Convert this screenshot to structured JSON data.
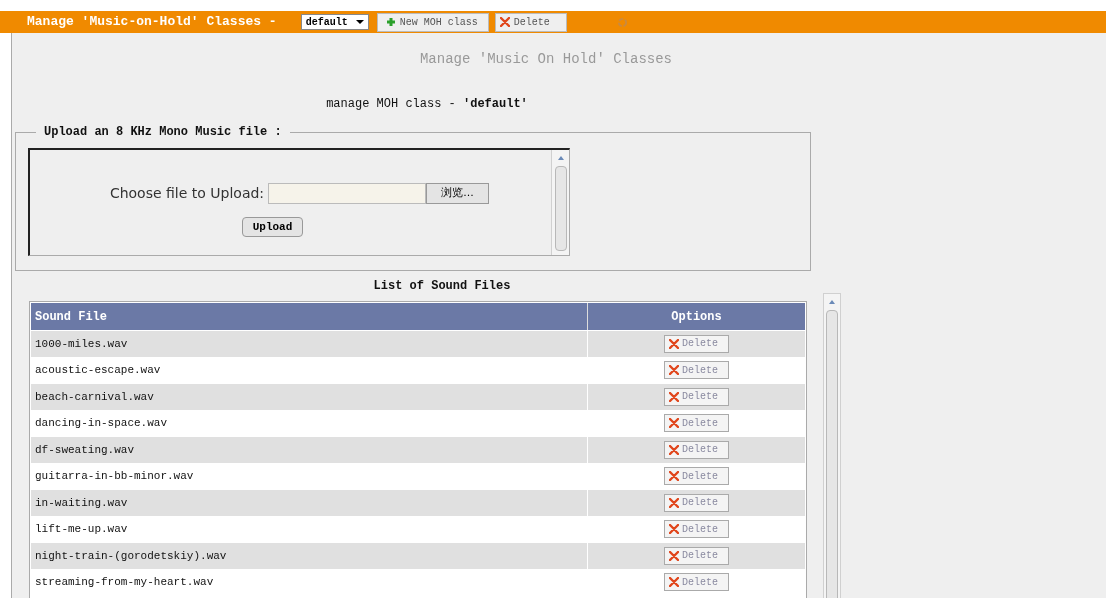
{
  "toolbar": {
    "title": "Manage 'Music-on-Hold' Classes -",
    "class_select": "default",
    "new_button": "New MOH class",
    "delete_button": "Delete"
  },
  "heading": "Manage 'Music On Hold' Classes",
  "subheading": "manage MOH class - **'default'**",
  "upload": {
    "legend": "Upload an 8 KHz Mono Music file :",
    "label": "Choose file to Upload:",
    "browse": "浏览...",
    "submit": "Upload"
  },
  "list_title": "List of Sound Files",
  "table": {
    "columns": [
      "Sound File",
      "Options"
    ],
    "rows": [
      {
        "file": "1000-miles.wav",
        "action": "Delete"
      },
      {
        "file": "acoustic-escape.wav",
        "action": "Delete"
      },
      {
        "file": "beach-carnival.wav",
        "action": "Delete"
      },
      {
        "file": "dancing-in-space.wav",
        "action": "Delete"
      },
      {
        "file": "df-sweating.wav",
        "action": "Delete"
      },
      {
        "file": "guitarra-in-bb-minor.wav",
        "action": "Delete"
      },
      {
        "file": "in-waiting.wav",
        "action": "Delete"
      },
      {
        "file": "lift-me-up.wav",
        "action": "Delete"
      },
      {
        "file": "night-train-(gorodetskiy).wav",
        "action": "Delete"
      },
      {
        "file": "streaming-from-my-heart.wav",
        "action": "Delete"
      }
    ]
  }
}
